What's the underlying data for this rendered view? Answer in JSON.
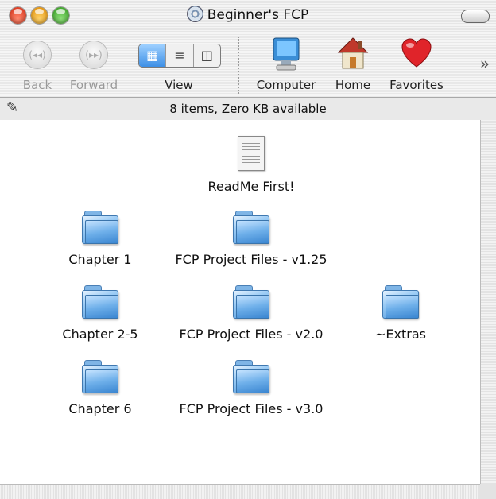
{
  "window": {
    "title": "Beginner's FCP"
  },
  "toolbar": {
    "back_label": "Back",
    "forward_label": "Forward",
    "view_label": "View",
    "computer_label": "Computer",
    "home_label": "Home",
    "favorites_label": "Favorites",
    "overflow": "»"
  },
  "status": {
    "text": "8 items, Zero KB available"
  },
  "items": [
    {
      "label": "ReadMe First!"
    },
    {
      "label": "Chapter 1"
    },
    {
      "label": "FCP Project Files - v1.25"
    },
    {
      "label": "Chapter 2-5"
    },
    {
      "label": "FCP Project Files - v2.0"
    },
    {
      "label": "~Extras"
    },
    {
      "label": "Chapter 6"
    },
    {
      "label": "FCP Project Files - v3.0"
    }
  ]
}
